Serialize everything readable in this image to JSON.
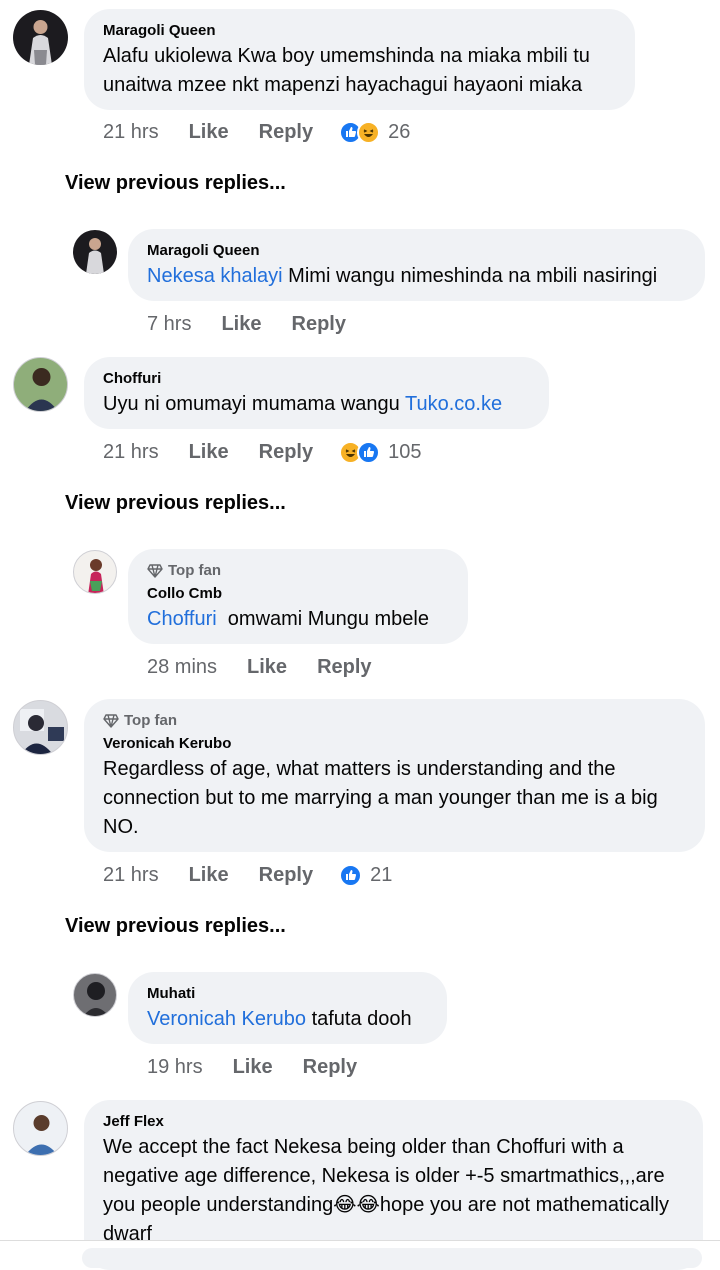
{
  "comments": [
    {
      "name": "Maragoli Queen",
      "text": "Alafu ukiolewa Kwa boy umemshinda na miaka mbili tu unaitwa mzee nkt mapenzi hayachagui hayaoni miaka",
      "time": "21 hrs",
      "like": "Like",
      "reply": "Reply",
      "reaction_count": "26",
      "reactions": [
        "like-icon",
        "haha-icon"
      ]
    },
    {
      "view_previous": "View previous replies..."
    },
    {
      "name": "Maragoli Queen",
      "mention": "Nekesa khalayi",
      "text": " Mimi wangu nimeshinda na mbili nasiringi",
      "time": "7 hrs",
      "like": "Like",
      "reply": "Reply"
    },
    {
      "name": "Choffuri",
      "text": "Uyu ni omumayi  mumama wangu ",
      "link": "Tuko.co.ke",
      "time": "21 hrs",
      "like": "Like",
      "reply": "Reply",
      "reaction_count": "105",
      "reactions": [
        "haha-icon",
        "like-icon"
      ]
    },
    {
      "view_previous": "View previous replies..."
    },
    {
      "badge": "Top fan",
      "name": "Collo Cmb",
      "mention": "Choffuri",
      "text": "  omwami Mungu mbele",
      "time": "28 mins",
      "like": "Like",
      "reply": "Reply"
    },
    {
      "badge": "Top fan",
      "name": "Veronicah Kerubo",
      "text": "Regardless of age, what matters is understanding and the connection but to me marrying a man younger than me is a big NO.",
      "time": "21 hrs",
      "like": "Like",
      "reply": "Reply",
      "reaction_count": "21",
      "reactions": [
        "like-icon"
      ]
    },
    {
      "view_previous": "View previous replies..."
    },
    {
      "name": "Muhati",
      "mention": "Veronicah Kerubo",
      "text": " tafuta dooh",
      "time": "19 hrs",
      "like": "Like",
      "reply": "Reply"
    },
    {
      "name": "Jeff Flex",
      "text": "We accept the fact Nekesa being older than Choffuri with a negative age difference, Nekesa is older +-5 smartmathics,,,are you people understanding😂😂hope you are not mathematically dwarf"
    }
  ],
  "colors": {
    "bubble": "#f0f2f5",
    "mention": "#216fdb",
    "meta": "#65676b",
    "like": "#1877f2",
    "haha": "#f7b125"
  }
}
